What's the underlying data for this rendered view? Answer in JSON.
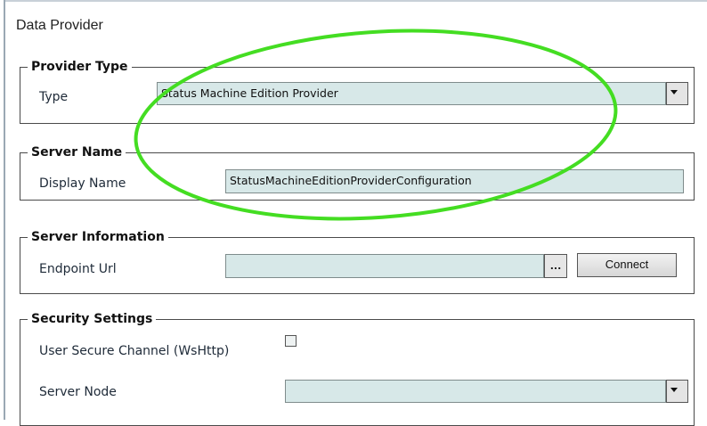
{
  "page": {
    "title": "Data Provider"
  },
  "provider_type": {
    "legend": "Provider Type",
    "type_label": "Type",
    "type_value": "Status Machine Edition Provider"
  },
  "server_name": {
    "legend": "Server Name",
    "display_name_label": "Display Name",
    "display_name_value": "StatusMachineEditionProviderConfiguration"
  },
  "server_information": {
    "legend": "Server Information",
    "endpoint_label": "Endpoint Url",
    "endpoint_value": "",
    "browse_label": "...",
    "connect_label": "Connect"
  },
  "security_settings": {
    "legend": "Security Settings",
    "secure_channel_label": "User Secure Channel (WsHttp)",
    "secure_channel_checked": false,
    "server_node_label": "Server Node",
    "server_node_value": ""
  },
  "colors": {
    "input_bg": "#d7e8e8",
    "annotation": "#44dd22"
  },
  "icons": [
    "chevron-down-icon",
    "ellipsis-icon",
    "checkbox-icon"
  ]
}
